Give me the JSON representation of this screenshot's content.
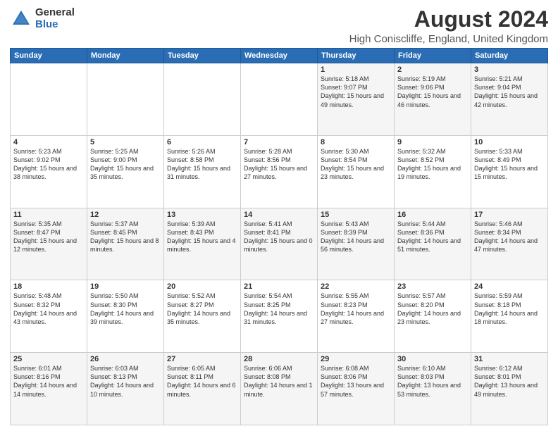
{
  "logo": {
    "general": "General",
    "blue": "Blue"
  },
  "header": {
    "month": "August 2024",
    "location": "High Coniscliffe, England, United Kingdom"
  },
  "weekdays": [
    "Sunday",
    "Monday",
    "Tuesday",
    "Wednesday",
    "Thursday",
    "Friday",
    "Saturday"
  ],
  "weeks": [
    [
      {
        "day": "",
        "sunrise": "",
        "sunset": "",
        "daylight": ""
      },
      {
        "day": "",
        "sunrise": "",
        "sunset": "",
        "daylight": ""
      },
      {
        "day": "",
        "sunrise": "",
        "sunset": "",
        "daylight": ""
      },
      {
        "day": "",
        "sunrise": "",
        "sunset": "",
        "daylight": ""
      },
      {
        "day": "1",
        "sunrise": "Sunrise: 5:18 AM",
        "sunset": "Sunset: 9:07 PM",
        "daylight": "Daylight: 15 hours and 49 minutes."
      },
      {
        "day": "2",
        "sunrise": "Sunrise: 5:19 AM",
        "sunset": "Sunset: 9:06 PM",
        "daylight": "Daylight: 15 hours and 46 minutes."
      },
      {
        "day": "3",
        "sunrise": "Sunrise: 5:21 AM",
        "sunset": "Sunset: 9:04 PM",
        "daylight": "Daylight: 15 hours and 42 minutes."
      }
    ],
    [
      {
        "day": "4",
        "sunrise": "Sunrise: 5:23 AM",
        "sunset": "Sunset: 9:02 PM",
        "daylight": "Daylight: 15 hours and 38 minutes."
      },
      {
        "day": "5",
        "sunrise": "Sunrise: 5:25 AM",
        "sunset": "Sunset: 9:00 PM",
        "daylight": "Daylight: 15 hours and 35 minutes."
      },
      {
        "day": "6",
        "sunrise": "Sunrise: 5:26 AM",
        "sunset": "Sunset: 8:58 PM",
        "daylight": "Daylight: 15 hours and 31 minutes."
      },
      {
        "day": "7",
        "sunrise": "Sunrise: 5:28 AM",
        "sunset": "Sunset: 8:56 PM",
        "daylight": "Daylight: 15 hours and 27 minutes."
      },
      {
        "day": "8",
        "sunrise": "Sunrise: 5:30 AM",
        "sunset": "Sunset: 8:54 PM",
        "daylight": "Daylight: 15 hours and 23 minutes."
      },
      {
        "day": "9",
        "sunrise": "Sunrise: 5:32 AM",
        "sunset": "Sunset: 8:52 PM",
        "daylight": "Daylight: 15 hours and 19 minutes."
      },
      {
        "day": "10",
        "sunrise": "Sunrise: 5:33 AM",
        "sunset": "Sunset: 8:49 PM",
        "daylight": "Daylight: 15 hours and 15 minutes."
      }
    ],
    [
      {
        "day": "11",
        "sunrise": "Sunrise: 5:35 AM",
        "sunset": "Sunset: 8:47 PM",
        "daylight": "Daylight: 15 hours and 12 minutes."
      },
      {
        "day": "12",
        "sunrise": "Sunrise: 5:37 AM",
        "sunset": "Sunset: 8:45 PM",
        "daylight": "Daylight: 15 hours and 8 minutes."
      },
      {
        "day": "13",
        "sunrise": "Sunrise: 5:39 AM",
        "sunset": "Sunset: 8:43 PM",
        "daylight": "Daylight: 15 hours and 4 minutes."
      },
      {
        "day": "14",
        "sunrise": "Sunrise: 5:41 AM",
        "sunset": "Sunset: 8:41 PM",
        "daylight": "Daylight: 15 hours and 0 minutes."
      },
      {
        "day": "15",
        "sunrise": "Sunrise: 5:43 AM",
        "sunset": "Sunset: 8:39 PM",
        "daylight": "Daylight: 14 hours and 56 minutes."
      },
      {
        "day": "16",
        "sunrise": "Sunrise: 5:44 AM",
        "sunset": "Sunset: 8:36 PM",
        "daylight": "Daylight: 14 hours and 51 minutes."
      },
      {
        "day": "17",
        "sunrise": "Sunrise: 5:46 AM",
        "sunset": "Sunset: 8:34 PM",
        "daylight": "Daylight: 14 hours and 47 minutes."
      }
    ],
    [
      {
        "day": "18",
        "sunrise": "Sunrise: 5:48 AM",
        "sunset": "Sunset: 8:32 PM",
        "daylight": "Daylight: 14 hours and 43 minutes."
      },
      {
        "day": "19",
        "sunrise": "Sunrise: 5:50 AM",
        "sunset": "Sunset: 8:30 PM",
        "daylight": "Daylight: 14 hours and 39 minutes."
      },
      {
        "day": "20",
        "sunrise": "Sunrise: 5:52 AM",
        "sunset": "Sunset: 8:27 PM",
        "daylight": "Daylight: 14 hours and 35 minutes."
      },
      {
        "day": "21",
        "sunrise": "Sunrise: 5:54 AM",
        "sunset": "Sunset: 8:25 PM",
        "daylight": "Daylight: 14 hours and 31 minutes."
      },
      {
        "day": "22",
        "sunrise": "Sunrise: 5:55 AM",
        "sunset": "Sunset: 8:23 PM",
        "daylight": "Daylight: 14 hours and 27 minutes."
      },
      {
        "day": "23",
        "sunrise": "Sunrise: 5:57 AM",
        "sunset": "Sunset: 8:20 PM",
        "daylight": "Daylight: 14 hours and 23 minutes."
      },
      {
        "day": "24",
        "sunrise": "Sunrise: 5:59 AM",
        "sunset": "Sunset: 8:18 PM",
        "daylight": "Daylight: 14 hours and 18 minutes."
      }
    ],
    [
      {
        "day": "25",
        "sunrise": "Sunrise: 6:01 AM",
        "sunset": "Sunset: 8:16 PM",
        "daylight": "Daylight: 14 hours and 14 minutes."
      },
      {
        "day": "26",
        "sunrise": "Sunrise: 6:03 AM",
        "sunset": "Sunset: 8:13 PM",
        "daylight": "Daylight: 14 hours and 10 minutes."
      },
      {
        "day": "27",
        "sunrise": "Sunrise: 6:05 AM",
        "sunset": "Sunset: 8:11 PM",
        "daylight": "Daylight: 14 hours and 6 minutes."
      },
      {
        "day": "28",
        "sunrise": "Sunrise: 6:06 AM",
        "sunset": "Sunset: 8:08 PM",
        "daylight": "Daylight: 14 hours and 1 minute."
      },
      {
        "day": "29",
        "sunrise": "Sunrise: 6:08 AM",
        "sunset": "Sunset: 8:06 PM",
        "daylight": "Daylight: 13 hours and 57 minutes."
      },
      {
        "day": "30",
        "sunrise": "Sunrise: 6:10 AM",
        "sunset": "Sunset: 8:03 PM",
        "daylight": "Daylight: 13 hours and 53 minutes."
      },
      {
        "day": "31",
        "sunrise": "Sunrise: 6:12 AM",
        "sunset": "Sunset: 8:01 PM",
        "daylight": "Daylight: 13 hours and 49 minutes."
      }
    ]
  ]
}
